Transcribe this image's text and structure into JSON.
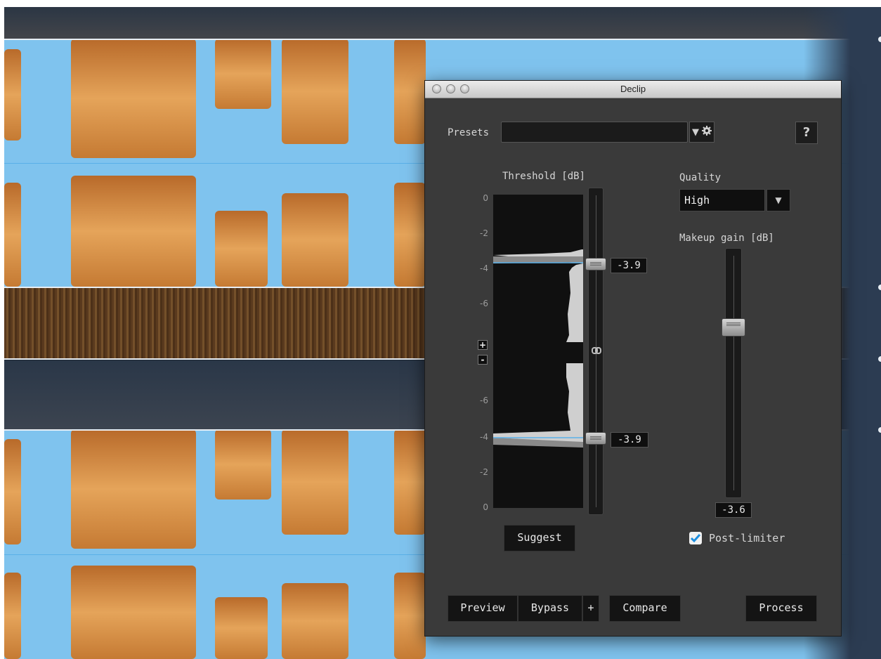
{
  "window": {
    "title": "Declip"
  },
  "presets": {
    "label": "Presets",
    "value": "",
    "help_label": "?"
  },
  "threshold": {
    "title": "Threshold [dB]",
    "ticks_upper": [
      "0",
      "-2",
      "-4",
      "-6"
    ],
    "ticks_lower": [
      "-6",
      "-4",
      "-2",
      "0"
    ],
    "plus_label": "+",
    "minus_label": "-",
    "upper_value": "-3.9",
    "lower_value": "-3.9",
    "suggest_label": "Suggest"
  },
  "quality": {
    "label": "Quality",
    "selected": "High"
  },
  "makeup_gain": {
    "label": "Makeup gain [dB]",
    "value": "-3.6"
  },
  "post_limiter": {
    "label": "Post-limiter",
    "checked": true
  },
  "footer": {
    "preview_label": "Preview",
    "bypass_label": "Bypass",
    "plus_label": "+",
    "compare_label": "Compare",
    "process_label": "Process"
  },
  "colors": {
    "dialog_bg": "#3a3a3a",
    "accent_line": "#5ab0e8",
    "checkbox_check": "#1d8fe0",
    "waveform": "#7fc3ee",
    "spectrogram": "#e5a45a"
  },
  "icons": [
    "dropdown-arrow-icon",
    "gear-icon",
    "help-icon",
    "link-icon",
    "checkmark-icon",
    "window-close-icon",
    "window-minimize-icon",
    "window-zoom-icon"
  ]
}
